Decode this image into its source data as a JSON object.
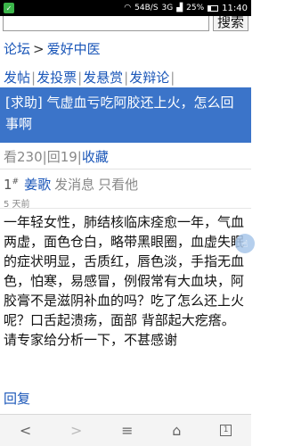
{
  "statusbar": {
    "net_speed": "54B/S",
    "signal": "3G",
    "battery": "25%",
    "time": "11:40"
  },
  "search": {
    "button_label": "搜索"
  },
  "breadcrumb": {
    "forum": "论坛",
    "separator": ">",
    "section": "爱好中医"
  },
  "actions": {
    "post": "发帖",
    "poll": "发投票",
    "reward": "发悬赏",
    "debate": "发辩论",
    "pipe": "|"
  },
  "thread": {
    "title": "[求助] 气虚血亏吃阿胶还上火，怎么回事啊",
    "views": "看230",
    "replies": "回19",
    "favorite": "收藏",
    "pipe": "|"
  },
  "post": {
    "floor": "1",
    "floor_mark": "#",
    "author": "姜歌",
    "send_message": "发消息",
    "only_op": "只看他",
    "time": "5 天前",
    "content": "一年轻女性，肺结核临床痊愈一年，气血两虚，面色仓白，略带黑眼圈，血虚失眠的症状明显，舌质红，唇色淡，手指无血色，怕寒，易感冒，例假常有大血块，阿胶膏不是滋阴补血的吗？吃了怎么还上火呢？口舌起溃疡，面部 背部起大疙瘩。 请专家给分析一下，不甚感谢",
    "reply": "回复"
  },
  "bottombar": {
    "back": "<",
    "forward": ">",
    "menu": "≡",
    "home": "⌂",
    "tabs": "1"
  }
}
